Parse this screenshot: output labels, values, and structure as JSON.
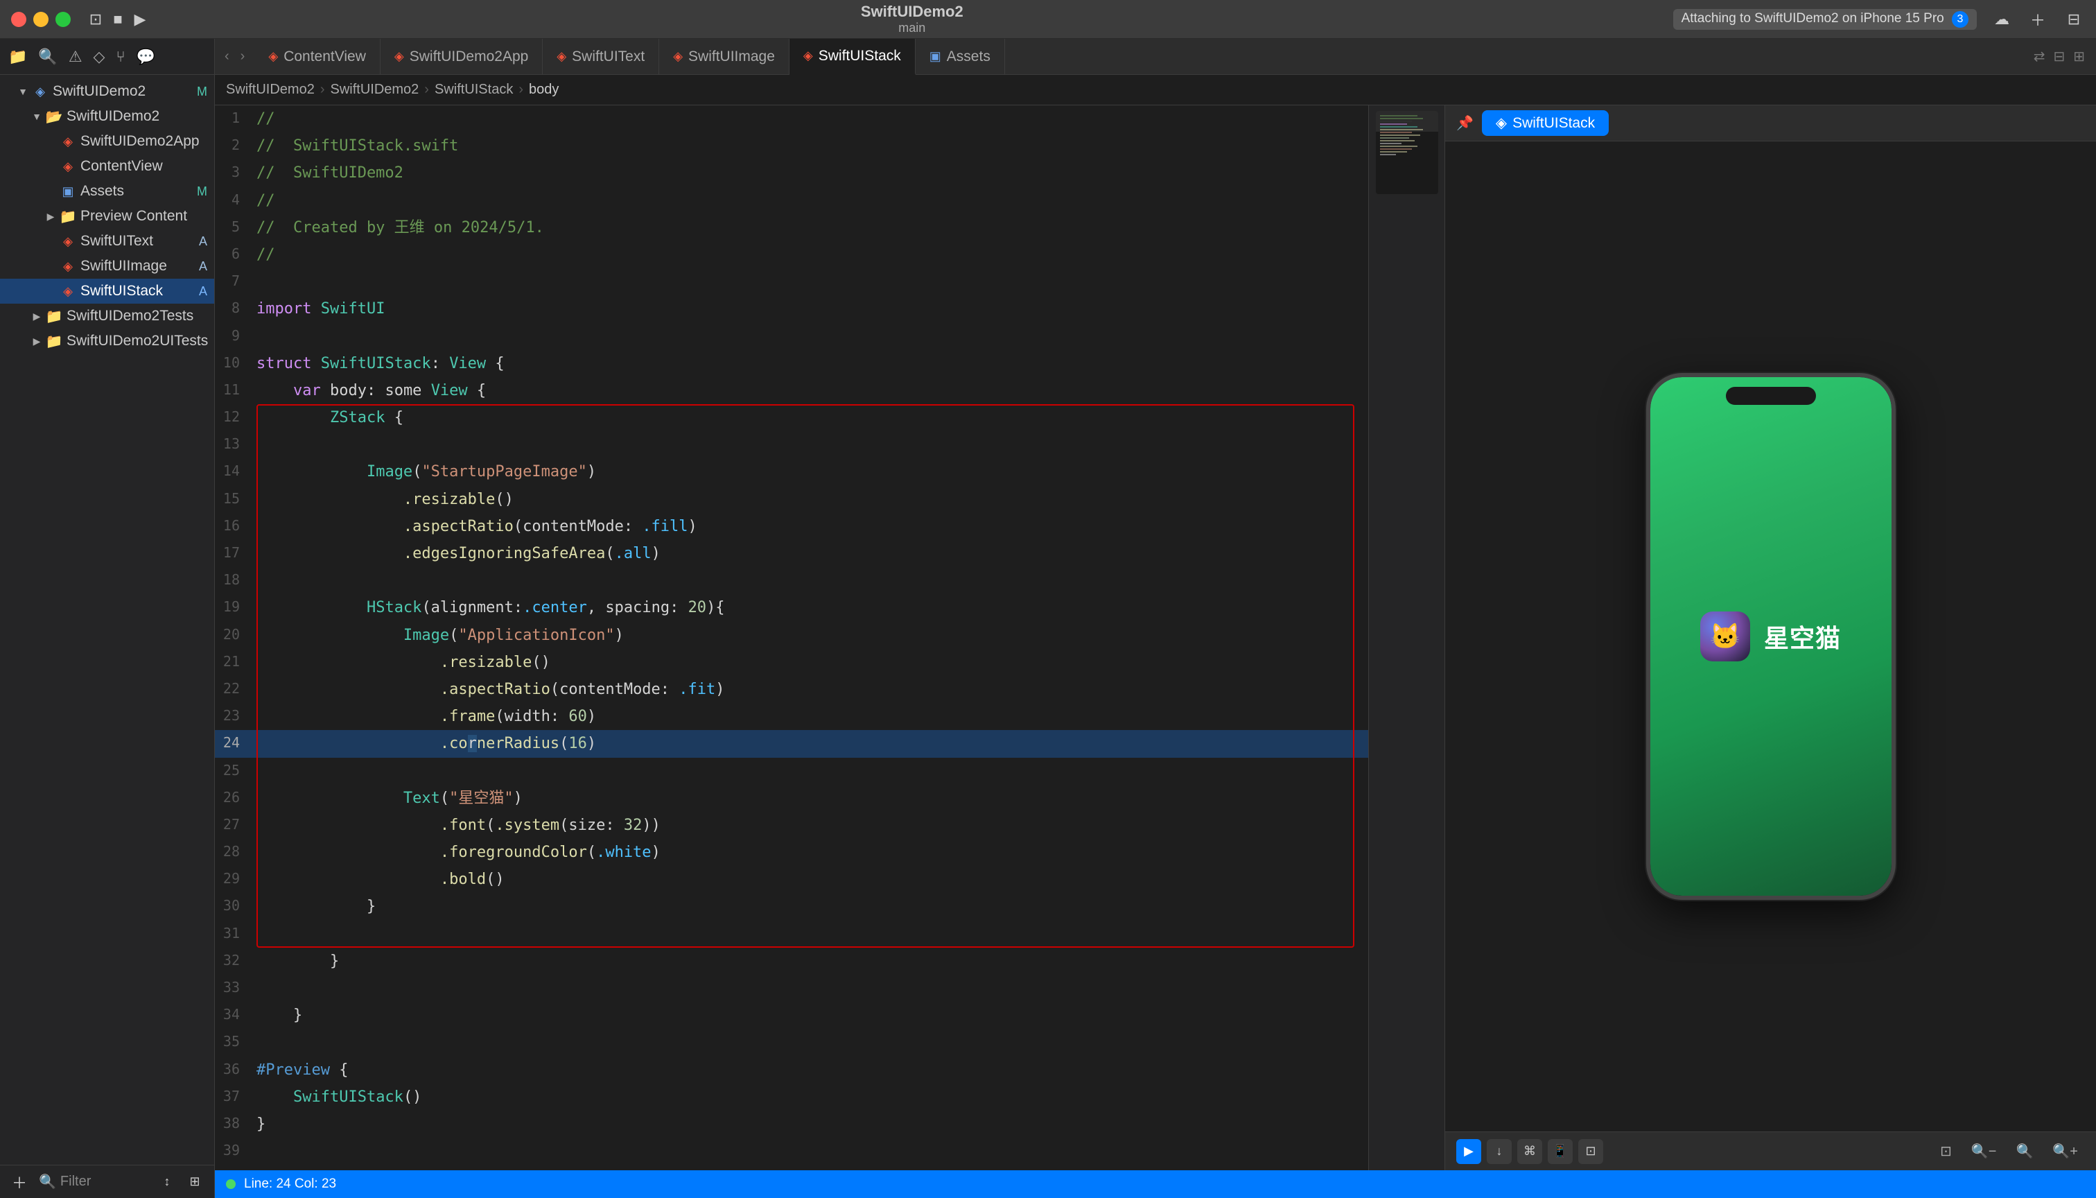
{
  "app": {
    "title": "SwiftUIDemo2",
    "subtitle": "main"
  },
  "titlebar": {
    "project": "SwiftUIDemo2",
    "main_label": "main",
    "device": "iPhone 15 Pro",
    "attaching_text": "Attaching to SwiftUIDemo2 on iPhone 15 Pro",
    "attaching_count": "3"
  },
  "tabs": [
    {
      "label": "ContentView",
      "type": "swift",
      "active": false
    },
    {
      "label": "SwiftUIDemo2App",
      "type": "swift",
      "active": false
    },
    {
      "label": "SwiftUIText",
      "type": "swift",
      "active": false
    },
    {
      "label": "SwiftUIImage",
      "type": "swift",
      "active": false
    },
    {
      "label": "SwiftUIStack",
      "type": "swift",
      "active": true
    },
    {
      "label": "Assets",
      "type": "assets",
      "active": false
    }
  ],
  "breadcrumb": {
    "items": [
      "SwiftUIDemo2",
      "SwiftUIDemo2",
      "SwiftUIStack",
      "body"
    ]
  },
  "sidebar": {
    "project_name": "SwiftUIDemo2",
    "items": [
      {
        "label": "SwiftUIDemo2",
        "level": 0,
        "type": "project",
        "badge": "M",
        "expanded": true
      },
      {
        "label": "SwiftUIDemo2",
        "level": 1,
        "type": "folder",
        "badge": "",
        "expanded": true
      },
      {
        "label": "SwiftUIDemo2App",
        "level": 2,
        "type": "swift",
        "badge": ""
      },
      {
        "label": "ContentView",
        "level": 2,
        "type": "swift",
        "badge": ""
      },
      {
        "label": "Assets",
        "level": 2,
        "type": "assets",
        "badge": "M"
      },
      {
        "label": "Preview Content",
        "level": 2,
        "type": "folder",
        "badge": "",
        "expanded": false
      },
      {
        "label": "SwiftUIText",
        "level": 2,
        "type": "swift",
        "badge": "A"
      },
      {
        "label": "SwiftUIImage",
        "level": 2,
        "type": "swift",
        "badge": "A"
      },
      {
        "label": "SwiftUIStack",
        "level": 2,
        "type": "swift",
        "badge": "A",
        "selected": true
      },
      {
        "label": "SwiftUIDemo2Tests",
        "level": 1,
        "type": "folder",
        "badge": "",
        "expanded": false
      },
      {
        "label": "SwiftUIDemo2UITests",
        "level": 1,
        "type": "folder",
        "badge": "",
        "expanded": false
      }
    ],
    "filter_placeholder": "Filter"
  },
  "code": {
    "filename": "SwiftUIStack.swift",
    "lines": [
      {
        "num": 1,
        "text": "//"
      },
      {
        "num": 2,
        "text": "//  SwiftUIStack.swift"
      },
      {
        "num": 3,
        "text": "//  SwiftUIDemo2"
      },
      {
        "num": 4,
        "text": "//"
      },
      {
        "num": 5,
        "text": "//  Created by 王维 on 2024/5/1."
      },
      {
        "num": 6,
        "text": "//"
      },
      {
        "num": 7,
        "text": ""
      },
      {
        "num": 8,
        "text": "import SwiftUI"
      },
      {
        "num": 9,
        "text": ""
      },
      {
        "num": 10,
        "text": "struct SwiftUIStack: View {"
      },
      {
        "num": 11,
        "text": "    var body: some View {"
      },
      {
        "num": 12,
        "text": "        ZStack {"
      },
      {
        "num": 13,
        "text": ""
      },
      {
        "num": 14,
        "text": "            Image(\"StartupPageImage\")"
      },
      {
        "num": 15,
        "text": "                .resizable()"
      },
      {
        "num": 16,
        "text": "                .aspectRatio(contentMode: .fill)"
      },
      {
        "num": 17,
        "text": "                .edgesIgnoringSafeArea(.all)"
      },
      {
        "num": 18,
        "text": ""
      },
      {
        "num": 19,
        "text": "            HStack(alignment:.center, spacing: 20){"
      },
      {
        "num": 20,
        "text": "                Image(\"ApplicationIcon\")"
      },
      {
        "num": 21,
        "text": "                    .resizable()"
      },
      {
        "num": 22,
        "text": "                    .aspectRatio(contentMode: .fit)"
      },
      {
        "num": 23,
        "text": "                    .frame(width: 60)"
      },
      {
        "num": 24,
        "text": "                    .cornerRadius(16)",
        "selected": true
      },
      {
        "num": 25,
        "text": ""
      },
      {
        "num": 26,
        "text": "                Text(\"星空猫\")"
      },
      {
        "num": 27,
        "text": "                    .font(.system(size: 32))"
      },
      {
        "num": 28,
        "text": "                    .foregroundColor(.white)"
      },
      {
        "num": 29,
        "text": "                    .bold()"
      },
      {
        "num": 30,
        "text": "            }"
      },
      {
        "num": 31,
        "text": ""
      },
      {
        "num": 32,
        "text": "        }"
      },
      {
        "num": 33,
        "text": ""
      },
      {
        "num": 34,
        "text": "    }"
      },
      {
        "num": 35,
        "text": ""
      },
      {
        "num": 36,
        "text": "#Preview {"
      },
      {
        "num": 37,
        "text": "    SwiftUIStack()"
      },
      {
        "num": 38,
        "text": "}"
      },
      {
        "num": 39,
        "text": ""
      }
    ]
  },
  "preview": {
    "tab_label": "SwiftUIStack",
    "app_title": "星空猫",
    "device_name": "iPhone 15 Pro"
  },
  "status": {
    "line": "24",
    "col": "23",
    "text": "Line: 24  Col: 23"
  }
}
